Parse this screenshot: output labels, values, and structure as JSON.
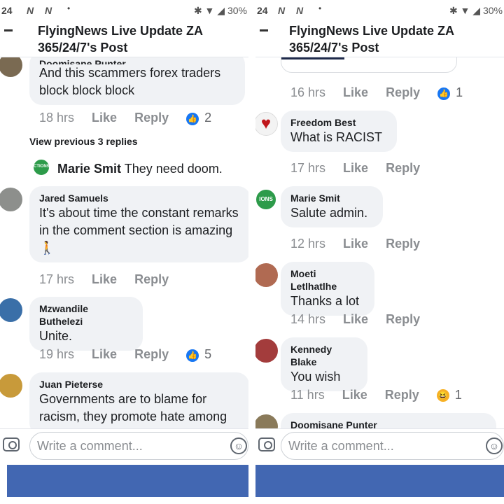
{
  "status": {
    "time": "24",
    "battery": "30%"
  },
  "left": {
    "header_title": "FlyingNews Live Update ZA 365/24/7's Post",
    "top_comment": {
      "author": "Doomisane Punter",
      "text": "And this scammers forex traders block block block",
      "time": "18 hrs",
      "like": "Like",
      "reply": "Reply",
      "reactions": "2"
    },
    "view_previous": "View previous 3 replies",
    "inline_reply": {
      "author": "Marie Smit",
      "text": "They need doom.",
      "avatar_text": "CTIONS"
    },
    "comments": [
      {
        "author": "Jared Samuels",
        "text": "It's about time the constant remarks in the comment section is amazing 🚶",
        "time": "17 hrs",
        "like": "Like",
        "reply": "Reply"
      },
      {
        "author": "Mzwandile Buthelezi",
        "text": "Unite.",
        "time": "19 hrs",
        "like": "Like",
        "reply": "Reply",
        "reactions": "5"
      },
      {
        "author": "Juan Pieterse",
        "text": "Governments are to blame for racism, they promote hate among"
      }
    ],
    "composer_placeholder": "Write a comment..."
  },
  "right": {
    "header_title": "FlyingNews Live Update ZA 365/24/7's Post",
    "top_meta": {
      "time": "16 hrs",
      "like": "Like",
      "reply": "Reply",
      "reactions": "1"
    },
    "comments": [
      {
        "author": "Freedom Best",
        "text": "What is RACIST",
        "time": "17 hrs",
        "like": "Like",
        "reply": "Reply"
      },
      {
        "author": "Marie Smit",
        "text": "Salute admin.",
        "time": "12 hrs",
        "like": "Like",
        "reply": "Reply",
        "avatar_text": "IONS"
      },
      {
        "author": "Moeti Letlhatlhe",
        "text": "Thanks a lot",
        "time": "14 hrs",
        "like": "Like",
        "reply": "Reply"
      },
      {
        "author": "Kennedy Blake",
        "text": "You wish",
        "time": "11 hrs",
        "like": "Like",
        "reply": "Reply",
        "reactions": "1"
      },
      {
        "author": "Doomisane Punter"
      }
    ],
    "composer_placeholder": "Write a comment..."
  },
  "colors": {
    "bubble": "#f0f2f5",
    "meta": "#8a8d91",
    "like_blue": "#1877f2",
    "bottom_bar": "#4267b2"
  }
}
